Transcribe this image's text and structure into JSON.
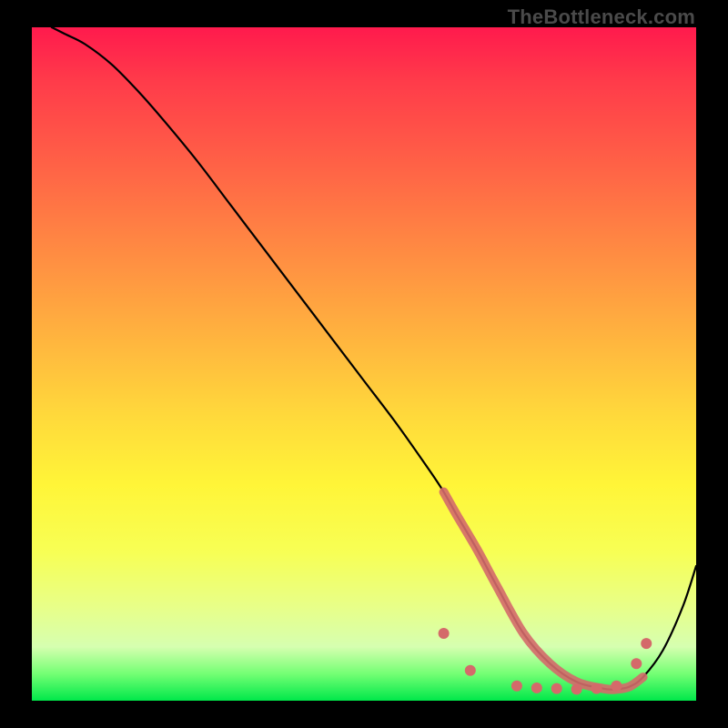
{
  "watermark": "TheBottleneck.com",
  "chart_data": {
    "type": "line",
    "title": "",
    "xlabel": "",
    "ylabel": "",
    "xlim": [
      0,
      100
    ],
    "ylim": [
      0,
      100
    ],
    "grid": false,
    "series": [
      {
        "name": "curve",
        "color": "#000000",
        "x": [
          3,
          5,
          8,
          12,
          16,
          20,
          25,
          30,
          35,
          40,
          45,
          50,
          55,
          60,
          62,
          64,
          67,
          70,
          74,
          78,
          82,
          86,
          88,
          90,
          92,
          95,
          98,
          100
        ],
        "y": [
          100,
          99,
          97.5,
          94.5,
          90.5,
          86,
          80,
          73.5,
          67,
          60.5,
          54,
          47.5,
          41,
          34,
          31,
          27.5,
          22.5,
          17,
          10,
          5.5,
          2.8,
          1.8,
          1.7,
          2.1,
          3.5,
          7.5,
          14,
          20
        ]
      }
    ],
    "markers": [
      {
        "x": 62,
        "y": 10,
        "color": "#d46a6a",
        "r": 6
      },
      {
        "x": 66,
        "y": 4.5,
        "color": "#d46a6a",
        "r": 6
      },
      {
        "x": 73,
        "y": 2.2,
        "color": "#d46a6a",
        "r": 6
      },
      {
        "x": 76,
        "y": 1.9,
        "color": "#d46a6a",
        "r": 6
      },
      {
        "x": 79,
        "y": 1.8,
        "color": "#d46a6a",
        "r": 6
      },
      {
        "x": 82,
        "y": 1.7,
        "color": "#d46a6a",
        "r": 6
      },
      {
        "x": 85,
        "y": 1.8,
        "color": "#d46a6a",
        "r": 6
      },
      {
        "x": 88,
        "y": 2.2,
        "color": "#d46a6a",
        "r": 6
      },
      {
        "x": 91,
        "y": 5.5,
        "color": "#d46a6a",
        "r": 6
      },
      {
        "x": 92.5,
        "y": 8.5,
        "color": "#d46a6a",
        "r": 6
      }
    ],
    "marker_region": {
      "x_start": 62,
      "x_end": 92.5
    }
  }
}
